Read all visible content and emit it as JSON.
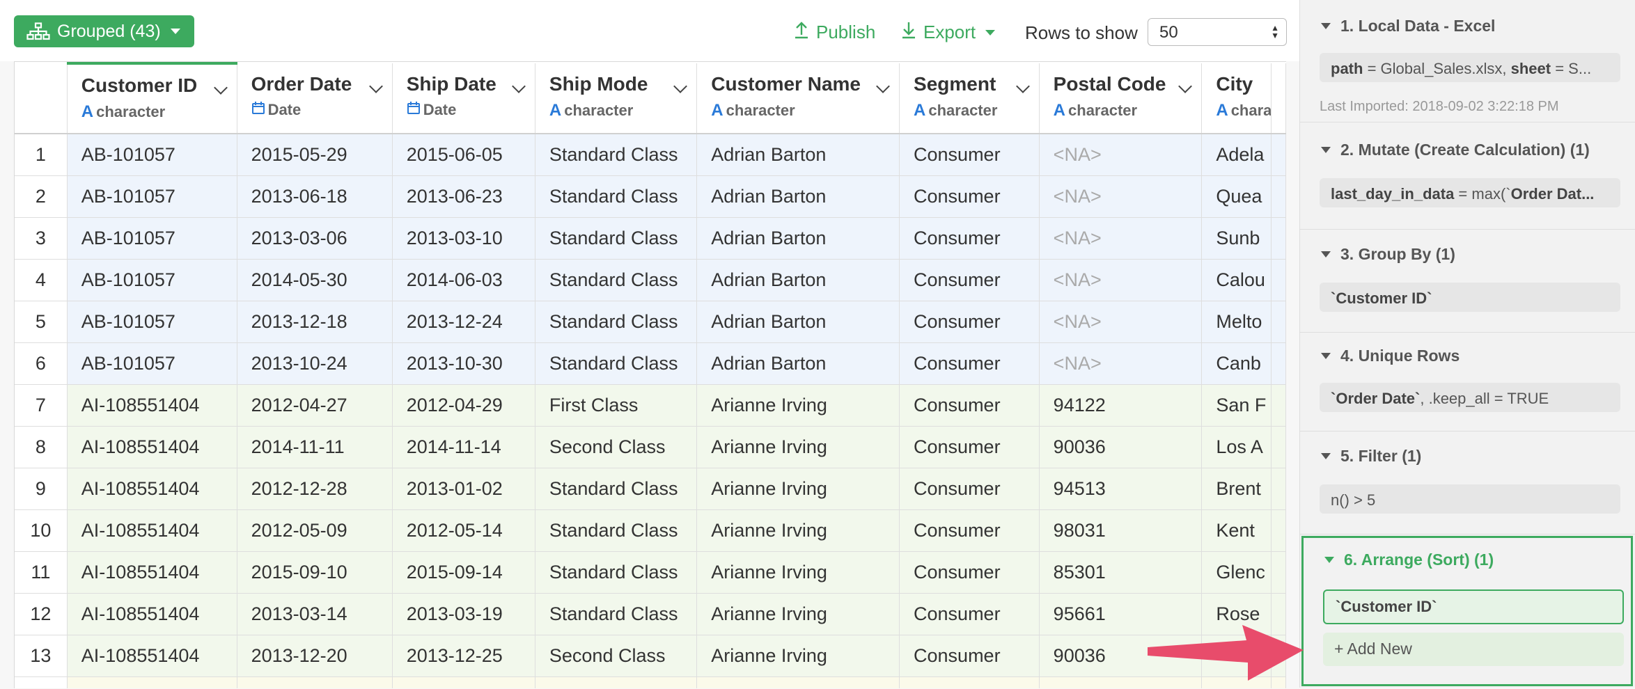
{
  "toolbar": {
    "grouped_label": "Grouped (43)",
    "publish_label": "Publish",
    "export_label": "Export",
    "rows_label": "Rows to show",
    "rows_value": "50",
    "accent_color": "#3daa5f"
  },
  "table": {
    "columns": [
      {
        "name": "Customer ID",
        "type": "character"
      },
      {
        "name": "Order Date",
        "type": "Date"
      },
      {
        "name": "Ship Date",
        "type": "Date"
      },
      {
        "name": "Ship Mode",
        "type": "character"
      },
      {
        "name": "Customer Name",
        "type": "character"
      },
      {
        "name": "Segment",
        "type": "character"
      },
      {
        "name": "Postal Code",
        "type": "character"
      },
      {
        "name": "City",
        "type": "chara"
      }
    ],
    "rows": [
      {
        "n": "1",
        "cells": [
          "AB-101057",
          "2015-05-29",
          "2015-06-05",
          "Standard Class",
          "Adrian Barton",
          "Consumer",
          "<NA>",
          "Adela"
        ]
      },
      {
        "n": "2",
        "cells": [
          "AB-101057",
          "2013-06-18",
          "2013-06-23",
          "Standard Class",
          "Adrian Barton",
          "Consumer",
          "<NA>",
          "Quea"
        ]
      },
      {
        "n": "3",
        "cells": [
          "AB-101057",
          "2013-03-06",
          "2013-03-10",
          "Standard Class",
          "Adrian Barton",
          "Consumer",
          "<NA>",
          "Sunb"
        ]
      },
      {
        "n": "4",
        "cells": [
          "AB-101057",
          "2014-05-30",
          "2014-06-03",
          "Standard Class",
          "Adrian Barton",
          "Consumer",
          "<NA>",
          "Calou"
        ]
      },
      {
        "n": "5",
        "cells": [
          "AB-101057",
          "2013-12-18",
          "2013-12-24",
          "Standard Class",
          "Adrian Barton",
          "Consumer",
          "<NA>",
          "Melto"
        ]
      },
      {
        "n": "6",
        "cells": [
          "AB-101057",
          "2013-10-24",
          "2013-10-30",
          "Standard Class",
          "Adrian Barton",
          "Consumer",
          "<NA>",
          "Canb"
        ]
      },
      {
        "n": "7",
        "cells": [
          "AI-108551404",
          "2012-04-27",
          "2012-04-29",
          "First Class",
          "Arianne Irving",
          "Consumer",
          "94122",
          "San F"
        ]
      },
      {
        "n": "8",
        "cells": [
          "AI-108551404",
          "2014-11-11",
          "2014-11-14",
          "Second Class",
          "Arianne Irving",
          "Consumer",
          "90036",
          "Los A"
        ]
      },
      {
        "n": "9",
        "cells": [
          "AI-108551404",
          "2012-12-28",
          "2013-01-02",
          "Standard Class",
          "Arianne Irving",
          "Consumer",
          "94513",
          "Brent"
        ]
      },
      {
        "n": "10",
        "cells": [
          "AI-108551404",
          "2012-05-09",
          "2012-05-14",
          "Standard Class",
          "Arianne Irving",
          "Consumer",
          "98031",
          "Kent"
        ]
      },
      {
        "n": "11",
        "cells": [
          "AI-108551404",
          "2015-09-10",
          "2015-09-14",
          "Standard Class",
          "Arianne Irving",
          "Consumer",
          "85301",
          "Glenc"
        ]
      },
      {
        "n": "12",
        "cells": [
          "AI-108551404",
          "2013-03-14",
          "2013-03-19",
          "Standard Class",
          "Arianne Irving",
          "Consumer",
          "95661",
          "Rose"
        ]
      },
      {
        "n": "13",
        "cells": [
          "AI-108551404",
          "2013-12-20",
          "2013-12-25",
          "Second Class",
          "Arianne Irving",
          "Consumer",
          "90036",
          ""
        ]
      }
    ]
  },
  "steps": {
    "s1": {
      "title": "1. Local Data - Excel",
      "box_key1": "path",
      "box_val1": " = Global_Sales.xlsx, ",
      "box_key2": "sheet",
      "box_val2": " = S...",
      "note": "Last Imported: 2018-09-02 3:22:18 PM"
    },
    "s2": {
      "title": "2. Mutate (Create Calculation) (1)",
      "box_key": "last_day_in_data",
      "box_val": " = max(`",
      "box_key2": "Order Dat..."
    },
    "s3": {
      "title": "3. Group By (1)",
      "box": "`Customer ID`"
    },
    "s4": {
      "title": "4. Unique Rows",
      "box_key": "`Order Date`",
      "box_val": ", .keep_all = TRUE"
    },
    "s5": {
      "title": "5. Filter (1)",
      "box": "n() > 5"
    },
    "s6": {
      "title": "6. Arrange (Sort) (1)",
      "box": "`Customer ID`",
      "add_new": "+ Add New"
    }
  }
}
